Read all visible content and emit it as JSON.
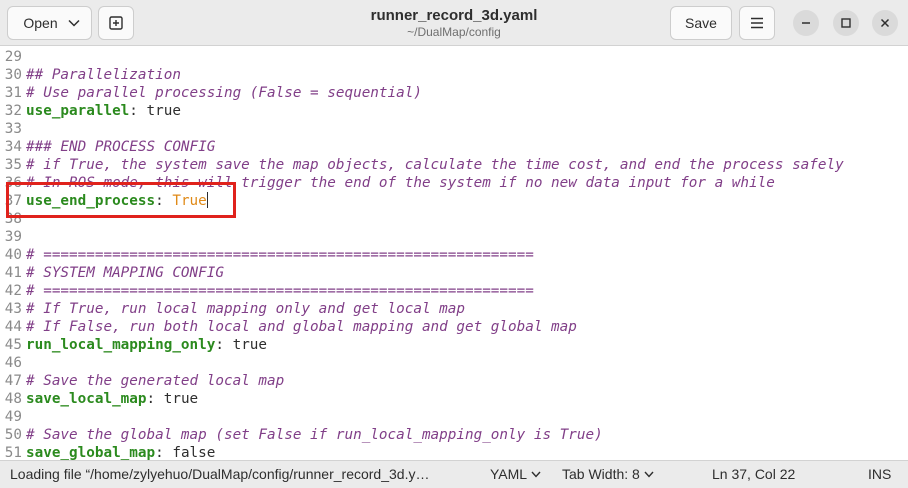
{
  "header": {
    "open_label": "Open",
    "title": "runner_record_3d.yaml",
    "subtitle": "~/DualMap/config",
    "save_label": "Save",
    "icons": {
      "open_menu": "chevron-down-icon",
      "new_tab": "new-tab-icon",
      "menu": "hamburger-menu-icon",
      "minimize": "minimize-icon",
      "maximize": "maximize-icon",
      "close": "close-icon"
    }
  },
  "editor": {
    "lines": [
      {
        "num": "29",
        "comment": "",
        "key": "",
        "value": ""
      },
      {
        "num": "30",
        "comment": "## Parallelization",
        "key": "",
        "value": ""
      },
      {
        "num": "31",
        "comment": "# Use parallel processing (False = sequential)",
        "key": "",
        "value": ""
      },
      {
        "num": "32",
        "comment": "",
        "key": "use_parallel",
        "value": "true"
      },
      {
        "num": "33",
        "comment": "",
        "key": "",
        "value": ""
      },
      {
        "num": "34",
        "comment": "### END PROCESS CONFIG",
        "key": "",
        "value": ""
      },
      {
        "num": "35",
        "comment": "# if True, the system save the map objects, calculate the time cost, and end the process safely",
        "key": "",
        "value": ""
      },
      {
        "num": "36",
        "comment": "# In ROS mode, this will trigger the end of the system if no new data input for a while",
        "key": "",
        "value": ""
      },
      {
        "num": "37",
        "comment": "",
        "key": "use_end_process",
        "value": "True"
      },
      {
        "num": "38",
        "comment": "",
        "key": "",
        "value": ""
      },
      {
        "num": "39",
        "comment": "",
        "key": "",
        "value": ""
      },
      {
        "num": "40",
        "comment": "# =========================================================",
        "key": "",
        "value": ""
      },
      {
        "num": "41",
        "comment": "# SYSTEM MAPPING CONFIG",
        "key": "",
        "value": ""
      },
      {
        "num": "42",
        "comment": "# =========================================================",
        "key": "",
        "value": ""
      },
      {
        "num": "43",
        "comment": "# If True, run local mapping only and get local map",
        "key": "",
        "value": ""
      },
      {
        "num": "44",
        "comment": "# If False, run both local and global mapping and get global map",
        "key": "",
        "value": ""
      },
      {
        "num": "45",
        "comment": "",
        "key": "run_local_mapping_only",
        "value": "true"
      },
      {
        "num": "46",
        "comment": "",
        "key": "",
        "value": ""
      },
      {
        "num": "47",
        "comment": "# Save the generated local map",
        "key": "",
        "value": ""
      },
      {
        "num": "48",
        "comment": "",
        "key": "save_local_map",
        "value": "true"
      },
      {
        "num": "49",
        "comment": "",
        "key": "",
        "value": ""
      },
      {
        "num": "50",
        "comment": "# Save the global map (set False if run_local_mapping_only is True)",
        "key": "",
        "value": ""
      },
      {
        "num": "51",
        "comment": "",
        "key": "save_global_map",
        "value": "false"
      }
    ],
    "highlight_line": "37",
    "highlight_color": "#e0221c"
  },
  "status": {
    "message": "Loading file “/home/zylyehuo/DualMap/config/runner_record_3d.y…",
    "language": "YAML",
    "tab_width": "Tab Width: 8",
    "position": "Ln 37, Col 22",
    "mode": "INS"
  },
  "colors": {
    "comment": "#813f88",
    "key": "#2b8a1e",
    "value_highlighted": "#e08a18"
  }
}
